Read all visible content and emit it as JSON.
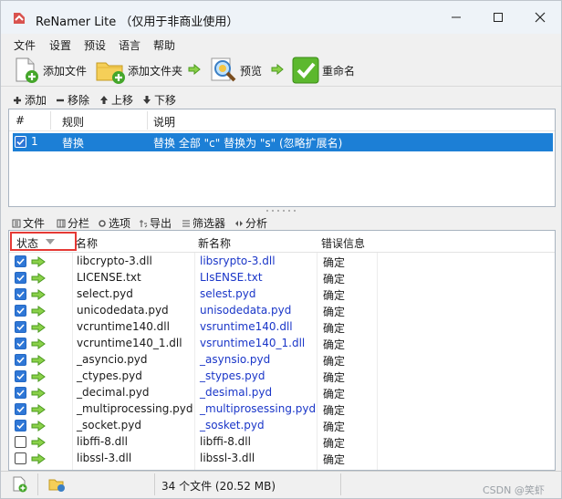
{
  "window": {
    "title": "ReNamer Lite （仅用于非商业使用）"
  },
  "menu": [
    "文件",
    "设置",
    "预设",
    "语言",
    "帮助"
  ],
  "toolbar": {
    "add_files": "添加文件",
    "add_folders": "添加文件夹",
    "preview": "预览",
    "rename": "重命名"
  },
  "rules_toolbar": {
    "add": "添加",
    "remove": "移除",
    "move_up": "上移",
    "move_down": "下移"
  },
  "rules": {
    "columns": [
      "#",
      "规则",
      "说明"
    ],
    "rows": [
      {
        "index": "1",
        "rule": "替换",
        "description": "替换 全部 \"c\" 替换为 \"s\" (忽略扩展名)",
        "checked": true
      }
    ]
  },
  "files_toolbar": {
    "files": "文件",
    "columns": "分栏",
    "options": "选项",
    "export": "导出",
    "filter": "筛选器",
    "analyze": "分析"
  },
  "files": {
    "columns": [
      "状态",
      "名称",
      "新名称",
      "错误信息"
    ],
    "rows": [
      {
        "checked": true,
        "arrow": true,
        "name": "libcrypto-3.dll",
        "new_name": "libsrypto-3.dll",
        "new_changed": true,
        "status": "确定"
      },
      {
        "checked": true,
        "arrow": true,
        "name": "LICENSE.txt",
        "new_name": "LIsENSE.txt",
        "new_changed": true,
        "status": "确定"
      },
      {
        "checked": true,
        "arrow": true,
        "name": "select.pyd",
        "new_name": "selest.pyd",
        "new_changed": true,
        "status": "确定"
      },
      {
        "checked": true,
        "arrow": true,
        "name": "unicodedata.pyd",
        "new_name": "unisodedata.pyd",
        "new_changed": true,
        "status": "确定"
      },
      {
        "checked": true,
        "arrow": true,
        "name": "vcruntime140.dll",
        "new_name": "vsruntime140.dll",
        "new_changed": true,
        "status": "确定"
      },
      {
        "checked": true,
        "arrow": true,
        "name": "vcruntime140_1.dll",
        "new_name": "vsruntime140_1.dll",
        "new_changed": true,
        "status": "确定"
      },
      {
        "checked": true,
        "arrow": true,
        "name": "_asyncio.pyd",
        "new_name": "_asynsio.pyd",
        "new_changed": true,
        "status": "确定"
      },
      {
        "checked": true,
        "arrow": true,
        "name": "_ctypes.pyd",
        "new_name": "_stypes.pyd",
        "new_changed": true,
        "status": "确定"
      },
      {
        "checked": true,
        "arrow": true,
        "name": "_decimal.pyd",
        "new_name": "_desimal.pyd",
        "new_changed": true,
        "status": "确定"
      },
      {
        "checked": true,
        "arrow": true,
        "name": "_multiprocessing.pyd",
        "new_name": "_multiprosessing.pyd",
        "new_changed": true,
        "status": "确定"
      },
      {
        "checked": true,
        "arrow": true,
        "name": "_socket.pyd",
        "new_name": "_sosket.pyd",
        "new_changed": true,
        "status": "确定"
      },
      {
        "checked": false,
        "arrow": true,
        "name": "libffi-8.dll",
        "new_name": "libffi-8.dll",
        "new_changed": false,
        "status": "确定"
      },
      {
        "checked": false,
        "arrow": true,
        "name": "libssl-3.dll",
        "new_name": "libssl-3.dll",
        "new_changed": false,
        "status": "确定"
      }
    ]
  },
  "statusbar": {
    "summary": "34 个文件 (20.52 MB)"
  },
  "watermark": "CSDN @笑虾",
  "colors": {
    "selection": "#1c7fd6",
    "new_name": "#1a36c8",
    "highlight_box": "#e53935",
    "arrow_green": "#4caf28"
  },
  "icons": [
    "app-icon",
    "add-file-icon",
    "add-folder-icon",
    "preview-icon",
    "rename-icon",
    "arrow-right-icon",
    "checkbox-icon",
    "sort-down-icon"
  ]
}
